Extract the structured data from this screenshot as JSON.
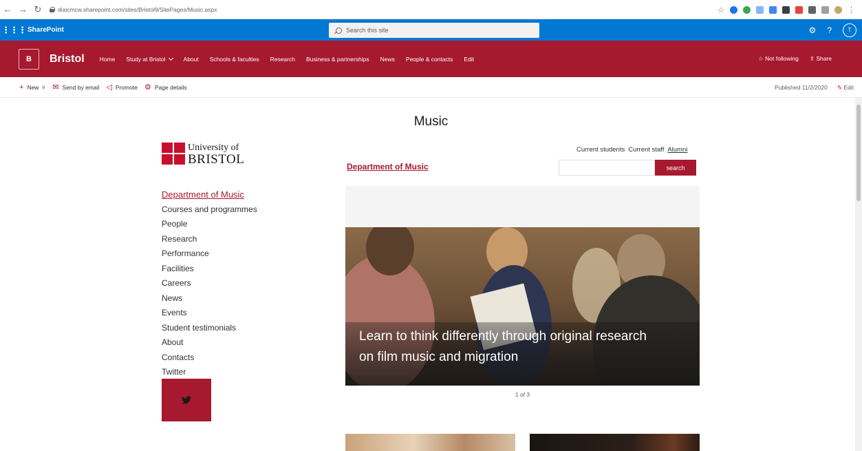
{
  "browser": {
    "url": "diaicmcw.sharepoint.com/sites/Bristol9/SitePages/Music.aspx"
  },
  "suitebar": {
    "brand": "SharePoint",
    "search_placeholder": "Search this site",
    "avatar_initial": "T"
  },
  "site": {
    "logo_letter": "B",
    "title": "Bristol",
    "nav": [
      "Home",
      "Study at Bristol",
      "About",
      "Schools & faculties",
      "Research",
      "Business & partnerships",
      "News",
      "People & contacts",
      "Edit"
    ],
    "follow_label": "Not following",
    "share_label": "Share"
  },
  "commandbar": {
    "new_label": "New",
    "email_label": "Send by email",
    "promote_label": "Promote",
    "details_label": "Page details",
    "published": "Published 11/2/2020",
    "edit_label": "Edit"
  },
  "page": {
    "title": "Music",
    "logo": {
      "line1": "University of",
      "line2": "BRISTOL"
    },
    "leftnav": [
      "Department of Music",
      "Courses and programmes",
      "People",
      "Research",
      "Performance",
      "Facilities",
      "Careers",
      "News",
      "Events",
      "Student testimonials",
      "About",
      "Contacts",
      "Twitter"
    ],
    "audience": {
      "students": "Current students",
      "staff": "Current staff",
      "alumni": "Alumni"
    },
    "dept_link": "Department of Music",
    "search_button": "search",
    "hero_caption": "Learn to think differently through original research on film music and migration",
    "slide_counter": "1 of 3"
  },
  "colors": {
    "suite_blue": "#0078d4",
    "brand_red": "#a6192e"
  }
}
